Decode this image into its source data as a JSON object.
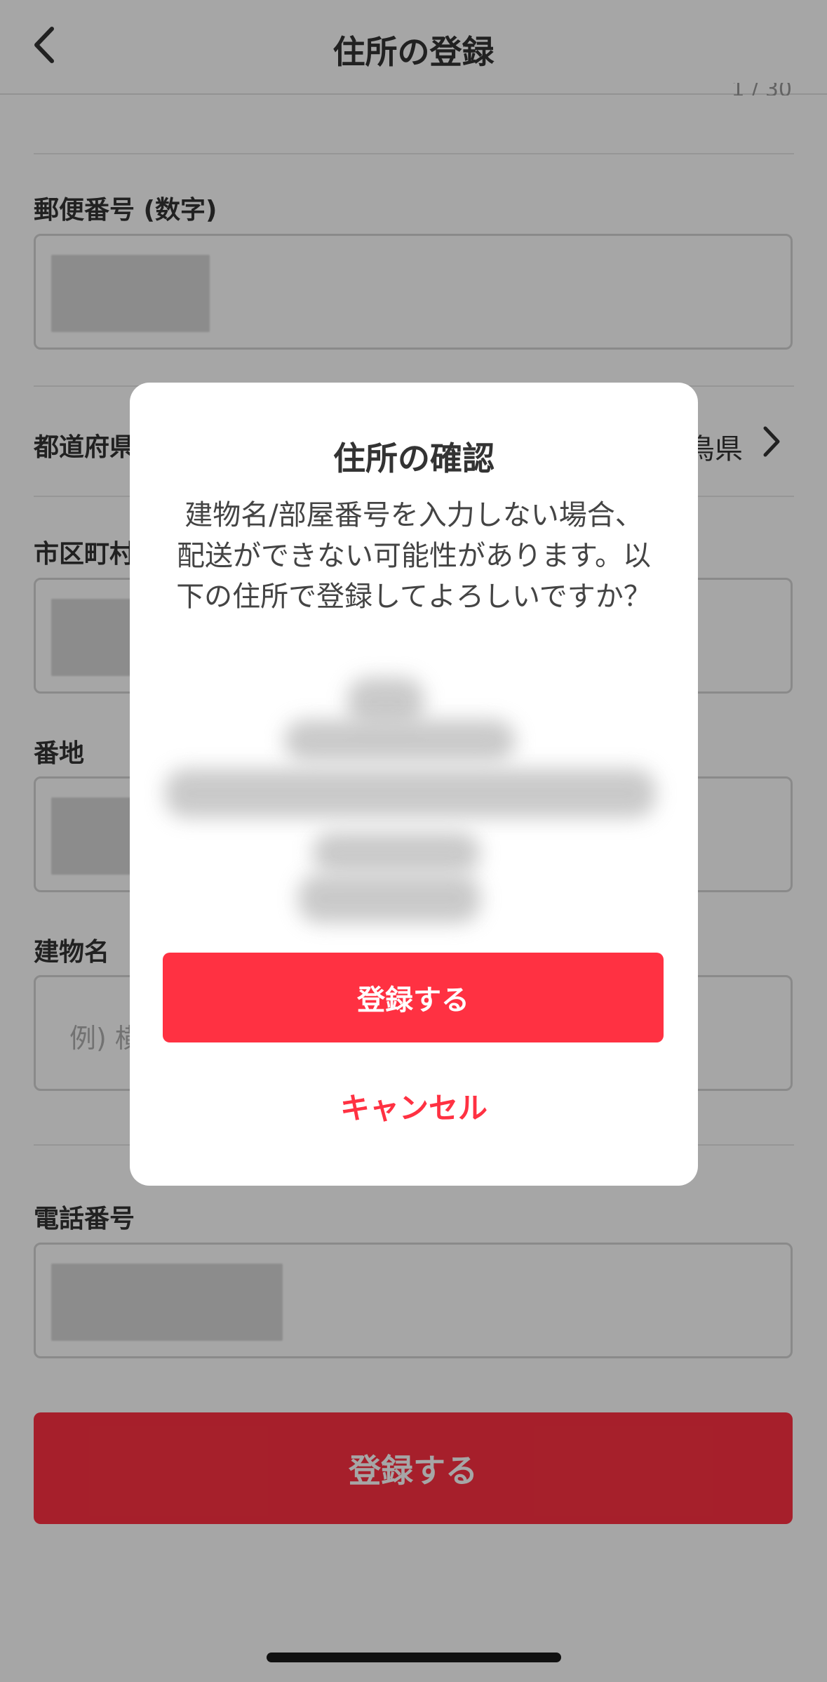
{
  "header": {
    "title": "住所の登録",
    "counter": "1 / 30"
  },
  "form": {
    "postal_label": "郵便番号 (数字)",
    "prefecture_label": "都道府県",
    "prefecture_value": "鳥県",
    "city_label": "市区町村",
    "address_label": "番地",
    "building_label": "建物名",
    "building_placeholder": "例) 横",
    "phone_label": "電話番号",
    "submit_label": "登録する"
  },
  "modal": {
    "title": "住所の確認",
    "message": "建物名/部屋番号を入力しない場合、配送ができない可能性があります。以下の住所で登録してよろしいですか？",
    "confirm_label": "登録する",
    "cancel_label": "キャンセル"
  },
  "colors": {
    "accent": "#ff3142",
    "overlay": "rgba(0,0,0,0.35)"
  },
  "icons": {
    "back": "chevron-left-icon",
    "prefecture": "chevron-right-icon"
  }
}
